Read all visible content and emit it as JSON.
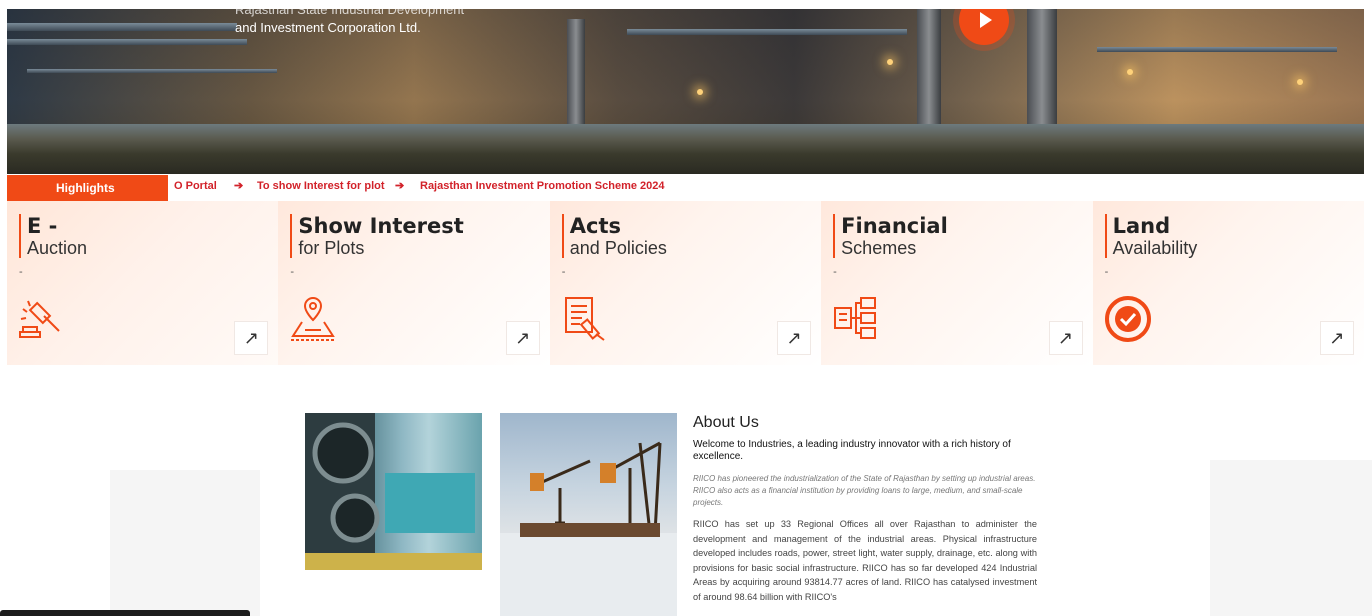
{
  "hero": {
    "title_line1": "Rajasthan State Industrial Development",
    "title_line2": "and Investment Corporation Ltd."
  },
  "highlights": {
    "label": "Highlights",
    "items": [
      "O Portal",
      "To show Interest for plot",
      "Rajasthan Investment Promotion Scheme 2024"
    ]
  },
  "cards": [
    {
      "title": "E -",
      "subtitle": "Auction",
      "dash": "-",
      "icon": "auction-gavel-icon"
    },
    {
      "title": "Show Interest",
      "subtitle": "for Plots",
      "dash": "-",
      "icon": "location-plot-icon"
    },
    {
      "title": "Acts",
      "subtitle": "and Policies",
      "dash": "-",
      "icon": "document-policy-icon"
    },
    {
      "title": "Financial",
      "subtitle": "Schemes",
      "dash": "-",
      "icon": "financial-network-icon"
    },
    {
      "title": "Land",
      "subtitle": "Availability",
      "dash": "-",
      "icon": "check-circle-icon"
    }
  ],
  "card_arrow": "↗",
  "about": {
    "heading": "About Us",
    "lead": "Welcome to Industries, a leading industry innovator with a rich history of excellence.",
    "italic": "RIICO has pioneered the industrialization of the State of Rajasthan by setting up industrial areas. RIICO also acts as a financial institution by providing loans to large, medium, and small-scale projects.",
    "body": "RIICO has set up 33 Regional Offices all over Rajasthan to administer the development and management of the industrial areas. Physical infrastructure developed includes roads, power, street light, water supply, drainage, etc. along with provisions for basic social infrastructure. RIICO has so far developed 424 Industrial Areas by acquiring around 93814.77 acres of land. RIICO has catalysed investment of around 98.64 billion with RIICO's"
  },
  "colors": {
    "accent": "#f04a16",
    "ticker_text": "#d2222a"
  }
}
